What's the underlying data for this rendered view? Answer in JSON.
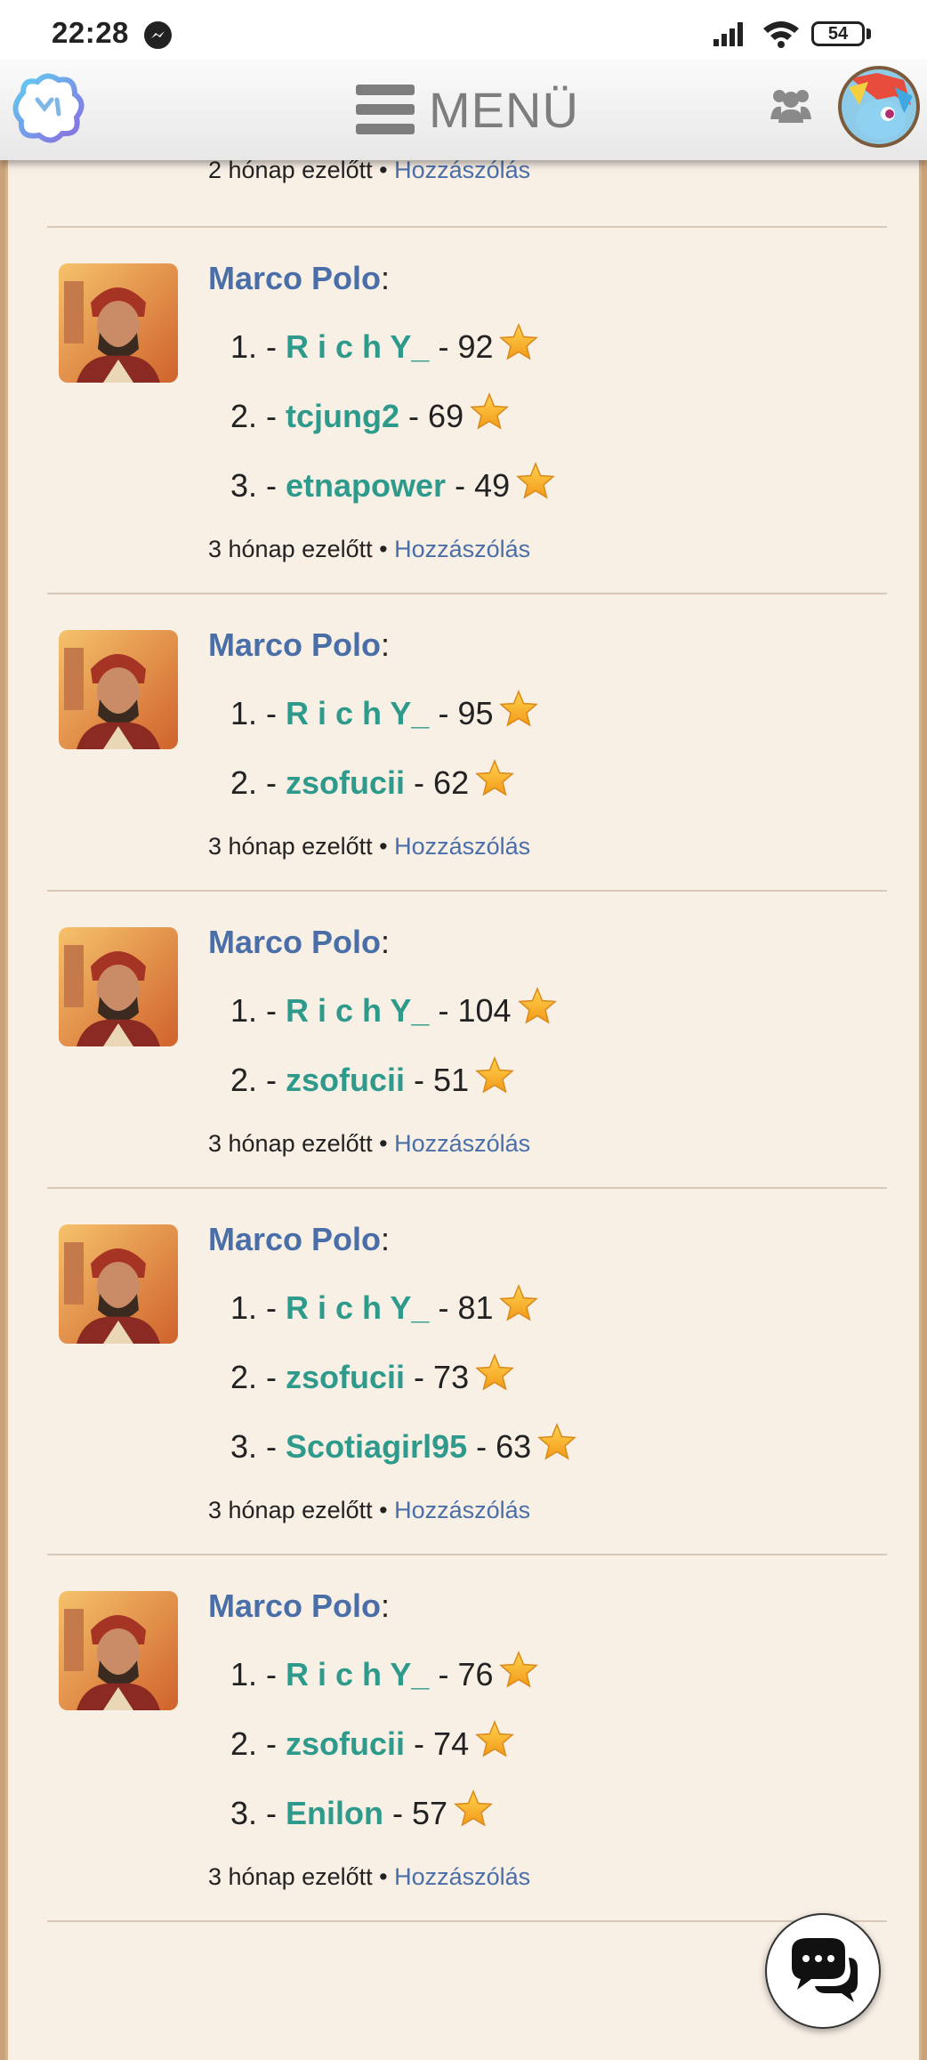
{
  "status_bar": {
    "time": "22:28",
    "battery": "54",
    "icons": [
      "messenger-icon",
      "signal-icon",
      "wifi-icon",
      "battery-icon"
    ]
  },
  "header": {
    "menu_label": "MENÜ",
    "icons": [
      "app-logo",
      "hamburger-icon",
      "friends-icon",
      "user-avatar"
    ]
  },
  "top_meta": {
    "time": "2 hónap ezelőtt",
    "separator": " • ",
    "comment": "Hozzászólás"
  },
  "posts": [
    {
      "author": "Marco Polo",
      "entries": [
        {
          "rank": "1.",
          "name": "R i c h Y_",
          "score": "92"
        },
        {
          "rank": "2.",
          "name": "tcjung2",
          "score": "69"
        },
        {
          "rank": "3.",
          "name": "etnapower",
          "score": "49"
        }
      ],
      "time": "3 hónap ezelőtt",
      "comment": "Hozzászólás"
    },
    {
      "author": "Marco Polo",
      "entries": [
        {
          "rank": "1.",
          "name": "R i c h Y_",
          "score": "95"
        },
        {
          "rank": "2.",
          "name": "zsofucii",
          "score": "62"
        }
      ],
      "time": "3 hónap ezelőtt",
      "comment": "Hozzászólás"
    },
    {
      "author": "Marco Polo",
      "entries": [
        {
          "rank": "1.",
          "name": "R i c h Y_",
          "score": "104"
        },
        {
          "rank": "2.",
          "name": "zsofucii",
          "score": "51"
        }
      ],
      "time": "3 hónap ezelőtt",
      "comment": "Hozzászólás"
    },
    {
      "author": "Marco Polo",
      "entries": [
        {
          "rank": "1.",
          "name": "R i c h Y_",
          "score": "81"
        },
        {
          "rank": "2.",
          "name": "zsofucii",
          "score": "73"
        },
        {
          "rank": "3.",
          "name": "Scotiagirl95",
          "score": "63"
        }
      ],
      "time": "3 hónap ezelőtt",
      "comment": "Hozzászólás"
    },
    {
      "author": "Marco Polo",
      "entries": [
        {
          "rank": "1.",
          "name": "R i c h Y_",
          "score": "76"
        },
        {
          "rank": "2.",
          "name": "zsofucii",
          "score": "74"
        },
        {
          "rank": "3.",
          "name": "Enilon",
          "score": "57"
        }
      ],
      "time": "3 hónap ezelőtt",
      "comment": "Hozzászólás"
    }
  ],
  "chat_button_icon": "chat-icon"
}
